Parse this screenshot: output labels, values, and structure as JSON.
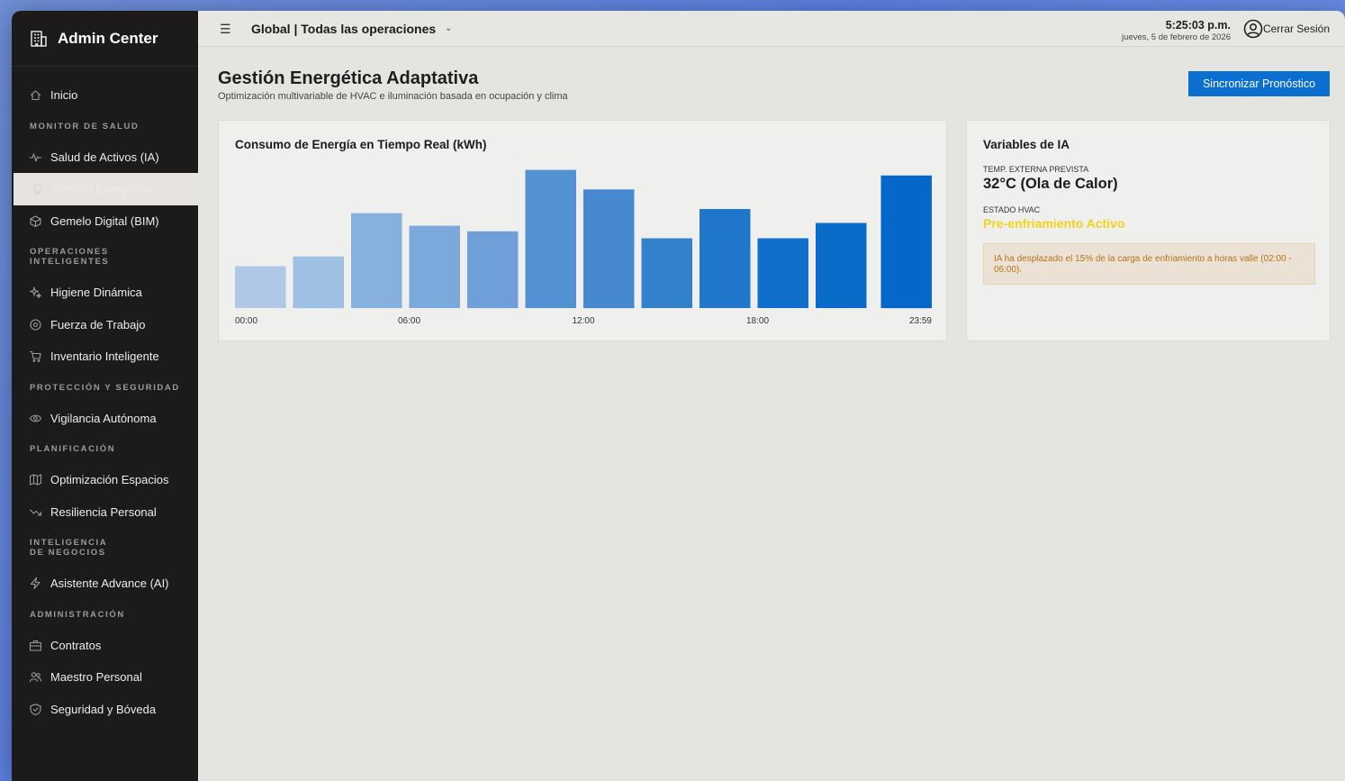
{
  "app": {
    "title": "Admin Center"
  },
  "sidebar": {
    "items": [
      {
        "type": "item",
        "label": "Inicio",
        "icon": "home-icon"
      },
      {
        "type": "section",
        "label": "MONITOR DE SALUD"
      },
      {
        "type": "item",
        "label": "Salud de Activos (IA)",
        "icon": "pulse-icon"
      },
      {
        "type": "item",
        "label": "Gestión Energética",
        "icon": "lightbulb-icon",
        "active": true
      },
      {
        "type": "item",
        "label": "Gemelo Digital (BIM)",
        "icon": "cube-icon"
      },
      {
        "type": "section",
        "label": "OPERACIONES INTELIGENTES"
      },
      {
        "type": "item",
        "label": "Higiene Dinámica",
        "icon": "sparkles-icon"
      },
      {
        "type": "item",
        "label": "Fuerza de Trabajo",
        "icon": "target-icon"
      },
      {
        "type": "item",
        "label": "Inventario Inteligente",
        "icon": "cart-icon"
      },
      {
        "type": "section",
        "label": "PROTECCIÓN Y SEGURIDAD"
      },
      {
        "type": "item",
        "label": "Vigilancia Autónoma",
        "icon": "eye-icon"
      },
      {
        "type": "section",
        "label": "PLANIFICACIÓN"
      },
      {
        "type": "item",
        "label": "Optimización Espacios",
        "icon": "map-icon"
      },
      {
        "type": "item",
        "label": "Resiliencia Personal",
        "icon": "trending-down-icon"
      },
      {
        "type": "section",
        "label": "INTELIGENCIA DE NEGOCIOS"
      },
      {
        "type": "item",
        "label": "Asistente Advance (AI)",
        "icon": "zap-icon"
      },
      {
        "type": "section",
        "label": "ADMINISTRACIÓN"
      },
      {
        "type": "item",
        "label": "Contratos",
        "icon": "briefcase-icon"
      },
      {
        "type": "item",
        "label": "Maestro Personal",
        "icon": "users-icon"
      },
      {
        "type": "item",
        "label": "Seguridad y Bóveda",
        "icon": "shield-icon"
      }
    ]
  },
  "header": {
    "scope": "Global | Todas las operaciones",
    "time": "5:25:03 p.m.",
    "date": "jueves, 5 de febrero de 2026",
    "logout": "Cerrar Sesión"
  },
  "page": {
    "title": "Gestión Energética Adaptativa",
    "subtitle": "Optimización multivariable de HVAC e iluminación basada en ocupación y clima",
    "sync_button": "Sincronizar Pronóstico"
  },
  "chart_data": {
    "type": "bar",
    "title": "Consumo de Energía en Tiempo Real (kWh)",
    "xlabel": "",
    "ylabel": "",
    "tick_labels": [
      "00:00",
      "06:00",
      "12:00",
      "18:00",
      "23:59"
    ],
    "values": [
      30,
      37,
      68,
      59,
      55,
      99,
      85,
      50,
      71,
      50,
      61,
      95
    ],
    "ylim": [
      0,
      100
    ],
    "grid": false,
    "legend": "none",
    "colors": [
      "#aec8e6",
      "#9ec0e3",
      "#86b1df",
      "#7ba9dc",
      "#6e9fd8",
      "#5392d2",
      "#4689cf",
      "#3380cc",
      "#1f76cb",
      "#0f6fca",
      "#0a6cc9",
      "#0568c9"
    ]
  },
  "ai_panel": {
    "title": "Variables de IA",
    "temp_label": "TEMP. EXTERNA PREVISTA",
    "temp_value": "32°C (Ola de Calor)",
    "hvac_label": "ESTADO HVAC",
    "hvac_value": "Pre-enfriamiento Activo",
    "note": "IA ha desplazado el 15% de la carga de enfriamiento a horas valle (02:00 - 06:00)."
  }
}
